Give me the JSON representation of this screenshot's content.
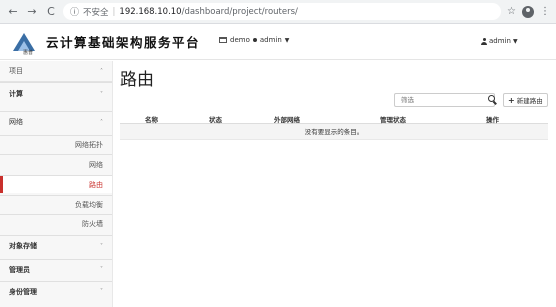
{
  "browser": {
    "nav_back": "←",
    "nav_forward": "→",
    "nav_reload": "C",
    "security_label": "不安全",
    "url_host": "192.168.10.10",
    "url_path": "/dashboard/project/routers/",
    "star": "☆",
    "menu": "⋮"
  },
  "header": {
    "logo_char": "惠普",
    "brand": "云计算基础架构服务平台",
    "project_label": "demo",
    "project_sep": "●",
    "project_user": "admin",
    "user_label": "admin"
  },
  "sidebar": {
    "items": [
      {
        "label": "项目",
        "type": "head",
        "chev": "˄"
      },
      {
        "label": "计算",
        "type": "group",
        "chev": "˅"
      },
      {
        "label": "网络",
        "type": "group",
        "chev": "˄"
      },
      {
        "label": "网络拓扑",
        "type": "sub"
      },
      {
        "label": "网络",
        "type": "sub"
      },
      {
        "label": "路由",
        "type": "sub",
        "selected": true
      },
      {
        "label": "负载均衡",
        "type": "sub"
      },
      {
        "label": "防火墙",
        "type": "sub"
      },
      {
        "label": "对象存储",
        "type": "group",
        "chev": "˅"
      },
      {
        "label": "管理员",
        "type": "group",
        "chev": "˅"
      },
      {
        "label": "身份管理",
        "type": "group",
        "chev": "˅"
      }
    ]
  },
  "main": {
    "title": "路由",
    "filter_placeholder": "筛选",
    "create_label": "新建路由",
    "columns": [
      "名称",
      "状态",
      "外部网络",
      "管理状态",
      "操作"
    ],
    "empty_message": "没有要显示的条目。"
  },
  "colors": {
    "accent": "#c9302c",
    "sidebar_bg": "#f7f7f7"
  }
}
